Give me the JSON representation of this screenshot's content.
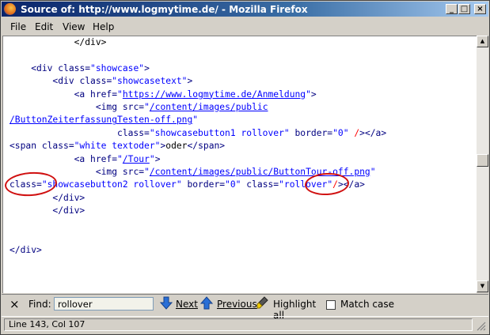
{
  "window": {
    "title": "Source of: http://www.logmytime.de/ - Mozilla Firefox",
    "controls": {
      "minimize": "_",
      "maximize": "□",
      "close": "×"
    }
  },
  "menu": {
    "items": [
      "File",
      "Edit",
      "View",
      "Help"
    ]
  },
  "source": {
    "l1": "            </div>",
    "l3_indent": "    ",
    "l3_tag": "<div ",
    "l3_attr": "class=",
    "l3_val": "\"showcase\"",
    "l3_end": ">",
    "l4_indent": "        ",
    "l4_tag": "<div ",
    "l4_attr": "class=",
    "l4_val": "\"showcasetext\"",
    "l4_end": ">",
    "l5_indent": "            ",
    "l5_tag": "<a ",
    "l5_attr": "href=",
    "l5_q1": "\"",
    "l5_link": "https://www.logmytime.de/Anmeldung",
    "l5_q2": "\"",
    "l5_end": ">",
    "l6_indent": "                ",
    "l6_tag": "<img ",
    "l6_attr": "src=",
    "l6_q1": "\"",
    "l6_link": "/content/images/public",
    "l7_link": "/ButtonZeiterfassungTesten-off.png",
    "l7_q2": "\"",
    "l8_indent": "                    ",
    "l8_a1": "class=",
    "l8_v1": "\"showcasebutton1 rollover\"",
    "l8_a2": " border=",
    "l8_v2": "\"0\"",
    "l8_sp": " ",
    "l8_slash": "/",
    "l8_end": "></a>",
    "l9_tag": "<span ",
    "l9_attr": "class=",
    "l9_val": "\"white textoder\"",
    "l9_end": ">",
    "l9_text": "oder",
    "l9_close": "</span>",
    "l10_indent": "            ",
    "l10_tag": "<a ",
    "l10_attr": "href=",
    "l10_q1": "\"",
    "l10_link": "/Tour",
    "l10_q2": "\"",
    "l10_end": ">",
    "l11_indent": "                ",
    "l11_tag": "<img ",
    "l11_attr": "src=",
    "l11_q1": "\"",
    "l11_link": "/content/images/public/ButtonTour-off.png",
    "l11_q2": "\"",
    "l12_a1": "class=",
    "l12_v1": "\"showcasebutton2 rollover\"",
    "l12_a2": " border=",
    "l12_v2": "\"0\"",
    "l12_sp": " ",
    "l12_a3": "class=",
    "l12_v3": "\"rollover\"",
    "l12_slash": "/",
    "l12_end": "></a>",
    "l13": "        </div>",
    "l14": "        </div>",
    "l17": "</div>"
  },
  "find_bar": {
    "close": "×",
    "label": "Find:",
    "query": "rollover",
    "next": "Next",
    "previous": "Previous",
    "highlight_all": "Highlight all",
    "match_case": "Match case"
  },
  "status": {
    "text": "Line 143, Col 107"
  },
  "colors": {
    "tag": "#000080",
    "attr_value": "#0000ff",
    "self_close_slash": "#ff0000",
    "annotation_ellipse": "#d01010"
  }
}
